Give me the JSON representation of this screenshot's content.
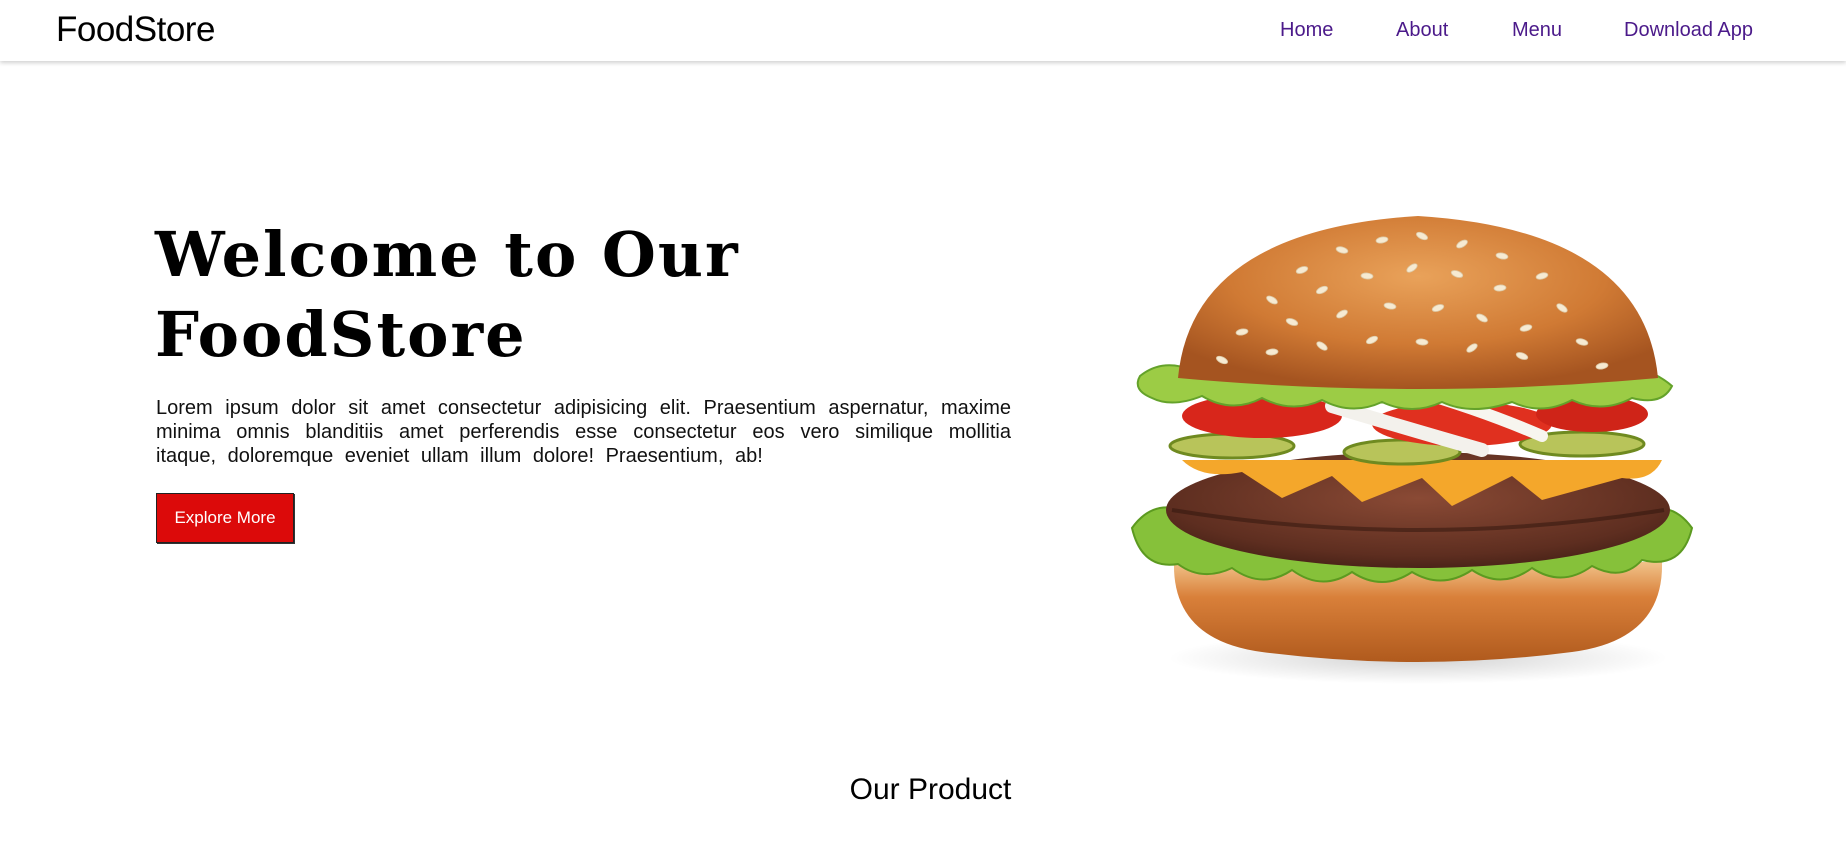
{
  "navbar": {
    "brand": "FoodStore",
    "links": [
      {
        "label": "Home"
      },
      {
        "label": "About"
      },
      {
        "label": "Menu"
      },
      {
        "label": "Download App"
      }
    ],
    "link_color": "#4b1a8a"
  },
  "hero": {
    "title": "Welcome to Our FoodStore",
    "description": "Lorem ipsum dolor sit amet consectetur adipisicing elit. Praesentium aspernatur, maxime minima omnis blanditiis amet perferendis esse consectetur eos vero similique mollitia itaque, doloremque eveniet ullam illum dolore! Praesentium, ab!",
    "cta_label": "Explore More",
    "cta_color": "#dc0a0a",
    "image": "burger-image"
  },
  "products": {
    "section_title": "Our Product"
  }
}
